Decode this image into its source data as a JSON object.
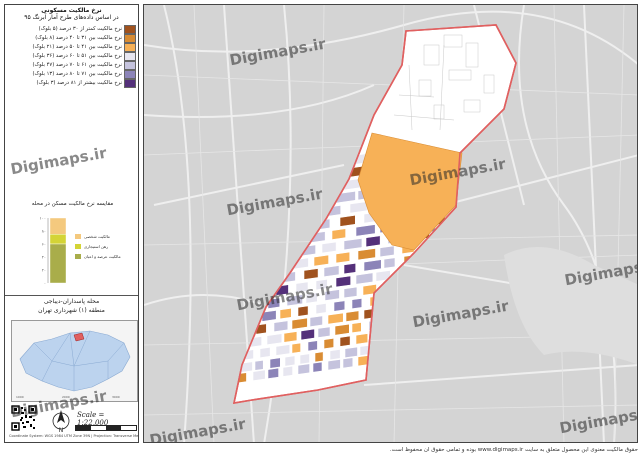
{
  "legend": {
    "title": "نرخ مالکیت مسکونی",
    "subtitle": "در اساس داده‌های طرح آمار آبرنگ ۹۵",
    "items": [
      {
        "label": "نرخ مالکیت کمتر از ۳۰ درصد (۵ بلوک)",
        "color": "#a0521e"
      },
      {
        "label": "نرخ مالکیت بین ۳۱ تا ۴۰ درصد (۸ بلوک)",
        "color": "#d98c33"
      },
      {
        "label": "نرخ مالکیت بین ۴۱ تا ۵۰ درصد (۲۱ بلوک)",
        "color": "#f7b157"
      },
      {
        "label": "نرخ مالکیت بین ۵۱ تا ۶۰ درصد (۳۶ بلوک)",
        "color": "#e7e6f0"
      },
      {
        "label": "نرخ مالکیت بین ۶۱ تا ۷۰ درصد (۴۷ بلوک)",
        "color": "#c5c3dd"
      },
      {
        "label": "نرخ مالکیت بین ۷۱ تا ۸۰ درصد (۱۳ بلوک)",
        "color": "#8c84b8"
      },
      {
        "label": "نرخ مالکیت بیشتر از ۸۱ درصد (۳ بلوک)",
        "color": "#54307a"
      }
    ]
  },
  "stack_chart": {
    "title": "مقایسه نرخ مالکیت مسکن در محله",
    "ticks": [
      "۱۰۰",
      "۸۰",
      "۶۰",
      "۴۰",
      "۲۰",
      "۰"
    ],
    "segments": [
      {
        "label": "مالکیت شخصی",
        "value": 0.25,
        "color": "#f4c97e"
      },
      {
        "label": "رهن استیجاری",
        "value": 0.15,
        "color": "#d4d436"
      },
      {
        "label": "مالکیت عرصه و اعیان",
        "value": 0.6,
        "color": "#a9ad4a"
      }
    ]
  },
  "region": {
    "line1": "محله پاسداران-دیباجی",
    "line2": "منطقه (۱) شهرداری تهران"
  },
  "footer": {
    "scale": "Scale = 1:22,000",
    "north": "N",
    "copyright": "Coordinate System: WGS 1984 UTM Zone 39N | Projection: Transverse Mercator"
  },
  "map": {
    "watermark": "Digimaps.ir",
    "colors": {
      "boundary": "#e06060",
      "roads": "#f2f2f2",
      "bg": "#d6d6d6"
    }
  },
  "bottom_note": "حقوق مالکیت معنوی این محصول متعلق به سایت www.digimaps.ir بوده و تمامی حقوق آن محفوظ است."
}
